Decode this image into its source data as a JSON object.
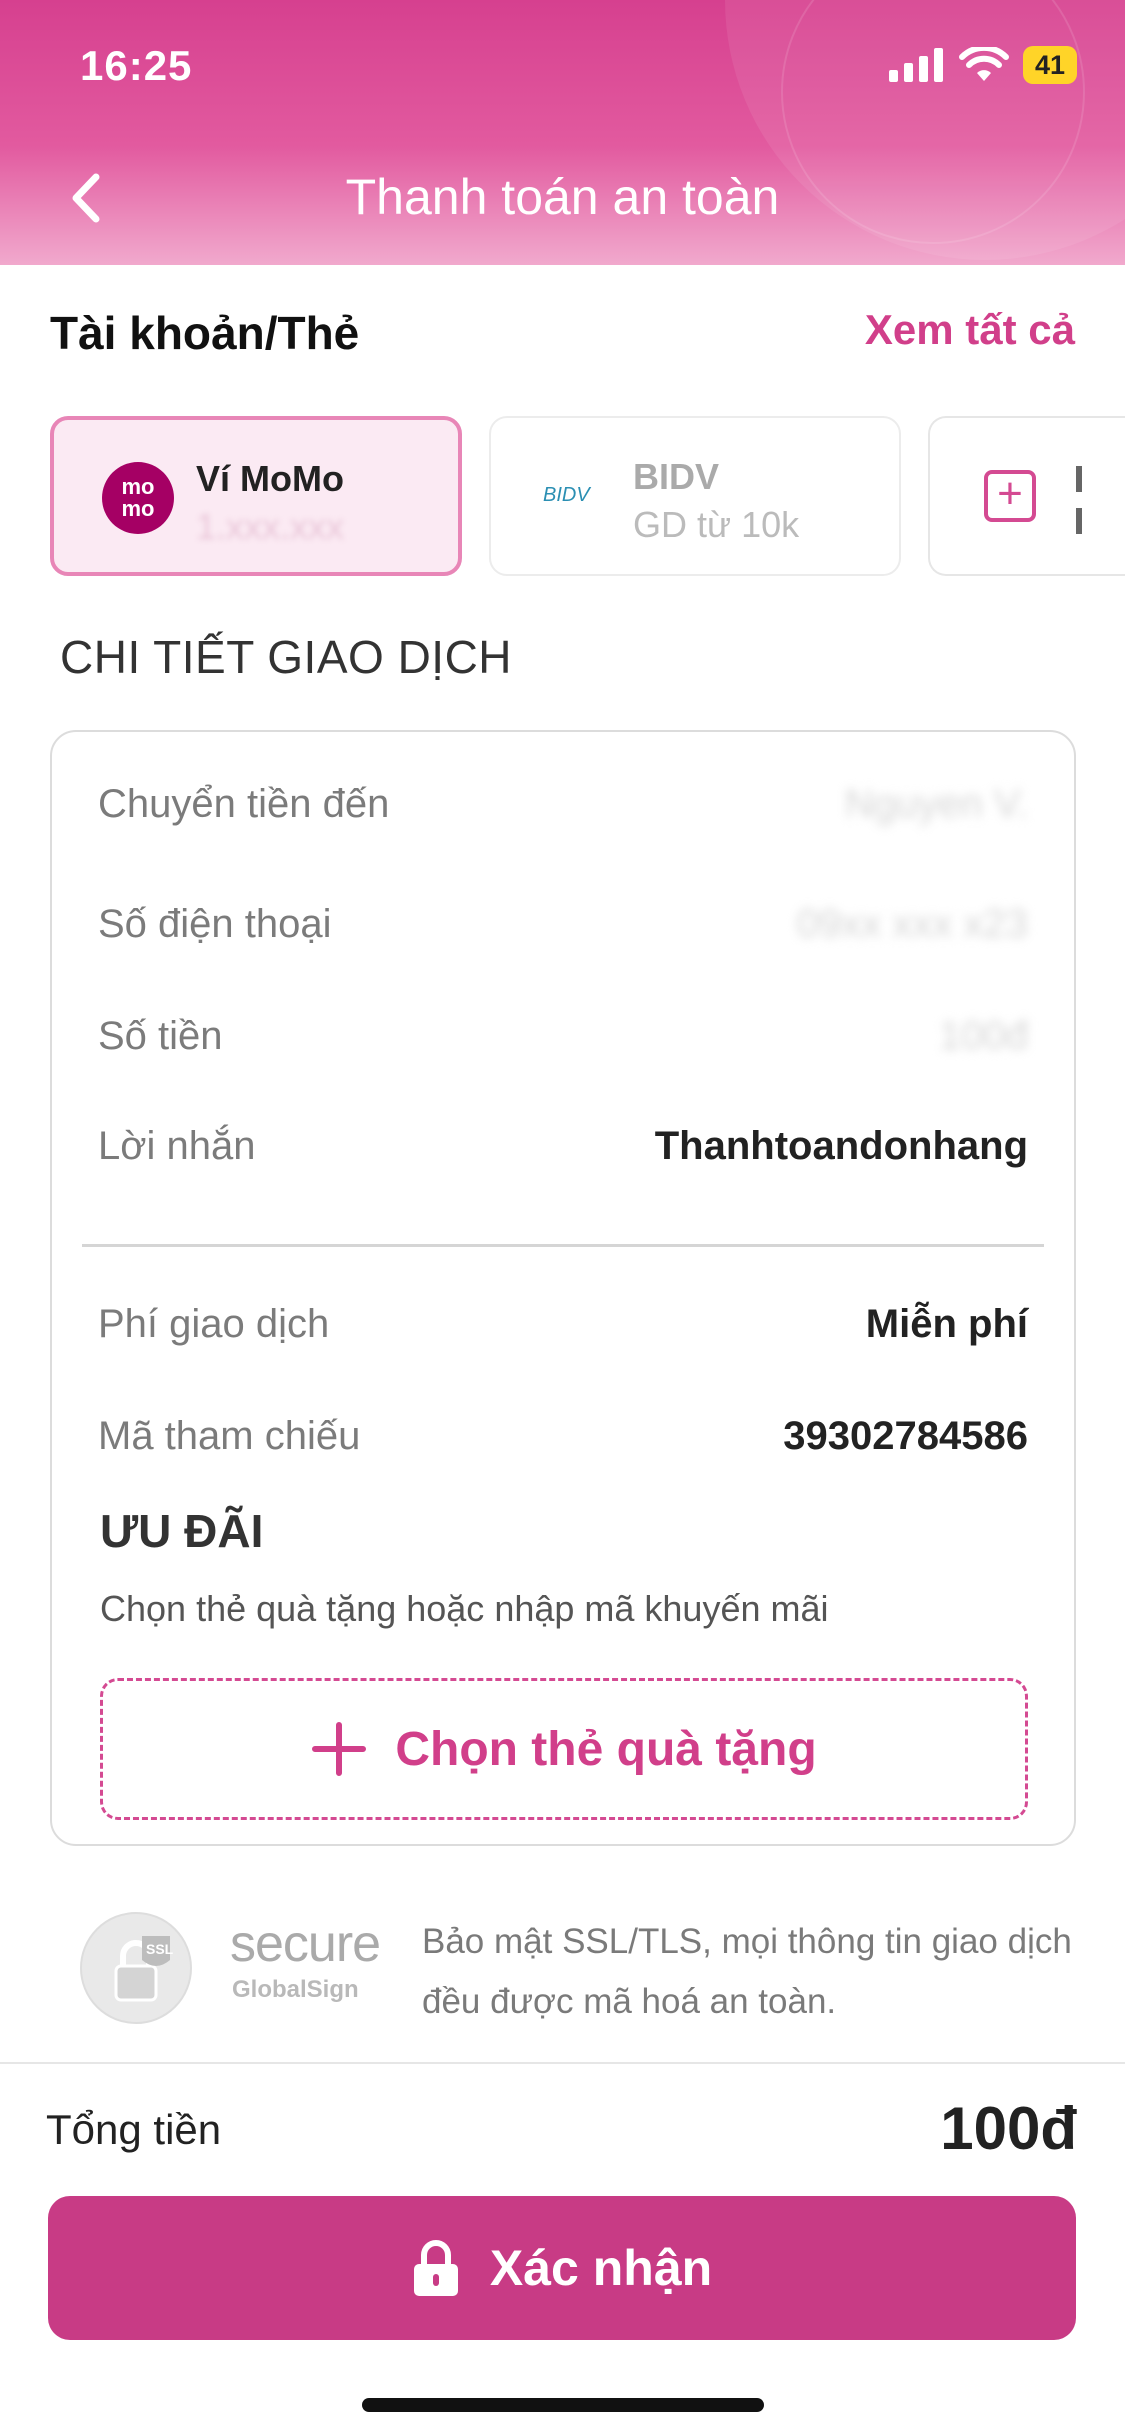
{
  "status_bar": {
    "time": "16:25",
    "battery": "41"
  },
  "nav": {
    "title": "Thanh toán an toàn"
  },
  "accounts": {
    "heading": "Tài khoản/Thẻ",
    "see_all": "Xem tất cả",
    "cards": [
      {
        "title": "Ví MoMo",
        "logo_text": "mo mo",
        "selected": true
      },
      {
        "title": "BIDV",
        "subtitle": "GD từ 10k",
        "logo_text": "BIDV",
        "selected": false
      }
    ]
  },
  "details": {
    "heading": "CHI TIẾT GIAO DỊCH",
    "rows": [
      {
        "label": "Chuyển tiền đến"
      },
      {
        "label": "Số điện thoại"
      },
      {
        "label": "Số tiền"
      },
      {
        "label": "Lời nhắn",
        "value": "Thanhtoandonhang"
      },
      {
        "label": "Phí giao dịch",
        "value": "Miễn phí"
      },
      {
        "label": "Mã tham chiếu",
        "value": "39302784586"
      }
    ]
  },
  "promo": {
    "title": "ƯU ĐÃI",
    "subtitle": "Chọn thẻ quà tặng hoặc nhập mã khuyến mãi",
    "gift_button": "Chọn thẻ quà tặng"
  },
  "security": {
    "badge_text": "secure",
    "badge_sub": "GlobalSign",
    "badge_ssl": "SSL",
    "note": "Bảo mật SSL/TLS, mọi thông tin giao dịch đều được mã hoá an toàn."
  },
  "footer": {
    "total_label": "Tổng tiền",
    "total_value": "100đ",
    "confirm_label": "Xác nhận"
  },
  "colors": {
    "accent": "#c83b85",
    "brand": "#a50064"
  }
}
